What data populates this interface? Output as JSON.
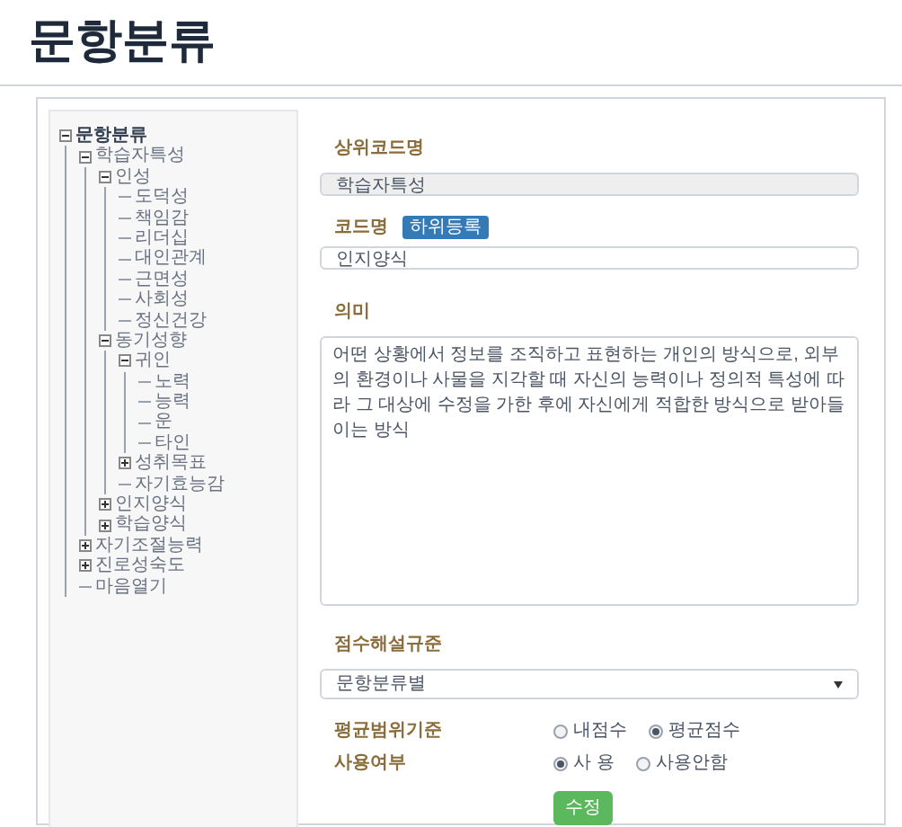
{
  "page_title": "문항분류",
  "tree": [
    {
      "label": "문항분류",
      "expanded": true,
      "children": [
        {
          "label": "학습자특성",
          "expanded": true,
          "children": [
            {
              "label": "인성",
              "expanded": true,
              "children": [
                {
                  "label": "도덕성"
                },
                {
                  "label": "책임감"
                },
                {
                  "label": "리더십"
                },
                {
                  "label": "대인관계"
                },
                {
                  "label": "근면성"
                },
                {
                  "label": "사회성"
                },
                {
                  "label": "정신건강"
                }
              ]
            },
            {
              "label": "동기성향",
              "expanded": true,
              "children": [
                {
                  "label": "귀인",
                  "expanded": true,
                  "children": [
                    {
                      "label": "노력"
                    },
                    {
                      "label": "능력"
                    },
                    {
                      "label": "운"
                    },
                    {
                      "label": "타인"
                    }
                  ]
                },
                {
                  "label": "성취목표",
                  "expanded": false
                },
                {
                  "label": "자기효능감"
                }
              ]
            },
            {
              "label": "인지양식",
              "expanded": false
            },
            {
              "label": "학습양식",
              "expanded": false
            }
          ]
        },
        {
          "label": "자기조절능력",
          "expanded": false
        },
        {
          "label": "진로성숙도",
          "expanded": false
        },
        {
          "label": "마음열기"
        }
      ]
    }
  ],
  "form": {
    "parent_code": {
      "label": "상위코드명",
      "value": "학습자특성",
      "disabled": true
    },
    "code_name": {
      "label": "코드명",
      "badge": "하위등록",
      "value": "인지양식"
    },
    "meaning": {
      "label": "의미",
      "value": "어떤 상황에서 정보를 조직하고 표현하는 개인의 방식으로, 외부의 환경이나 사물을 지각할 때 자신의 능력이나 정의적 특성에 따라 그 대상에 수정을 가한 후에 자신에게 적합한 방식으로 받아들이는 방식"
    },
    "score_rule": {
      "label": "점수해설규준",
      "value": "문항분류별"
    },
    "avg_range": {
      "label": "평균범위기준",
      "options": [
        {
          "label": "내점수",
          "selected": false
        },
        {
          "label": "평균점수",
          "selected": true
        }
      ]
    },
    "usage": {
      "label": "사용여부",
      "options": [
        {
          "label": "사 용",
          "selected": true
        },
        {
          "label": "사용안함",
          "selected": false
        }
      ]
    },
    "submit": "수정"
  }
}
